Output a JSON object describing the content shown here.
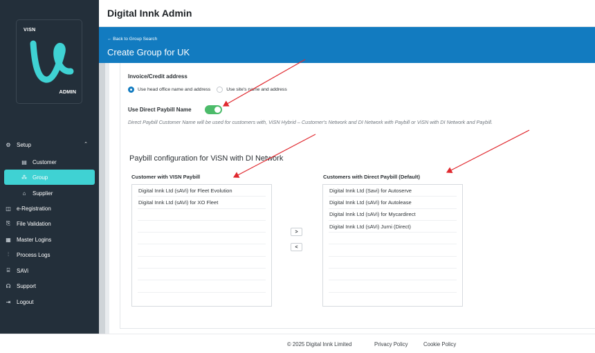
{
  "app": {
    "title": "Digital Innk Admin"
  },
  "logo": {
    "top_text": "VISN",
    "bottom_text": "ADMIN",
    "accent": "#3fd2d3"
  },
  "sidebar": {
    "setup": {
      "label": "Setup",
      "icon": "gear-icon"
    },
    "items": [
      {
        "label": "Customer",
        "icon": "document-icon"
      },
      {
        "label": "Group",
        "icon": "group-icon",
        "active": true
      },
      {
        "label": "Supplier",
        "icon": "store-icon"
      },
      {
        "label": "e-Registration",
        "icon": "clipboard-icon"
      },
      {
        "label": "File Validation",
        "icon": "file-check-icon"
      },
      {
        "label": "Master Logins",
        "icon": "grid-icon"
      },
      {
        "label": "Process Logs",
        "icon": "bar-chart-icon"
      },
      {
        "label": "SAVi",
        "icon": "bank-icon"
      },
      {
        "label": "Support",
        "icon": "headset-icon"
      },
      {
        "label": "Logout",
        "icon": "logout-icon"
      }
    ]
  },
  "header": {
    "back_link": "← Back to Group Search",
    "page_title": "Create Group for UK",
    "bar_color": "#127bc0"
  },
  "form": {
    "invoice_label": "Invoice/Credit address",
    "radio_options": [
      {
        "label": "Use head office name and address",
        "selected": true
      },
      {
        "label": "Use site's name and address",
        "selected": false
      }
    ],
    "direct_paybill_label": "Use Direct Paybill Name",
    "direct_paybill_enabled": true,
    "help_text": "Direct Paybill Customer Name will be used for customers with, ViSN Hybrid – Customer's Network and DI Network with Paybill or ViSN with DI Network and Paybill."
  },
  "paybill": {
    "section_title": "Paybill configuration for ViSN with DI Network",
    "left_title": "Customer with VISN Paybill",
    "right_title": "Customers with Direct Paybill (Default)",
    "left_items": [
      "Digital Innk Ltd (sAVi) for Fleet Evolution",
      "Digital Innk Ltd (sAVi) for XO Fleet"
    ],
    "right_items": [
      "Digital Innk Ltd (Savi) for Autoserve",
      "Digital Innk Ltd (sAVi) for Autolease",
      "Digital Innk Ltd (sAVi) for Mycardirect",
      "Digital Innk Ltd (sAVi) Jurni (Direct)"
    ],
    "move_right_label": ">",
    "move_left_label": "<"
  },
  "footer": {
    "copyright": "© 2025 Digital Innk Limited",
    "privacy": "Privacy Policy",
    "cookie": "Cookie Policy"
  },
  "annotation_color": "#e0282e"
}
